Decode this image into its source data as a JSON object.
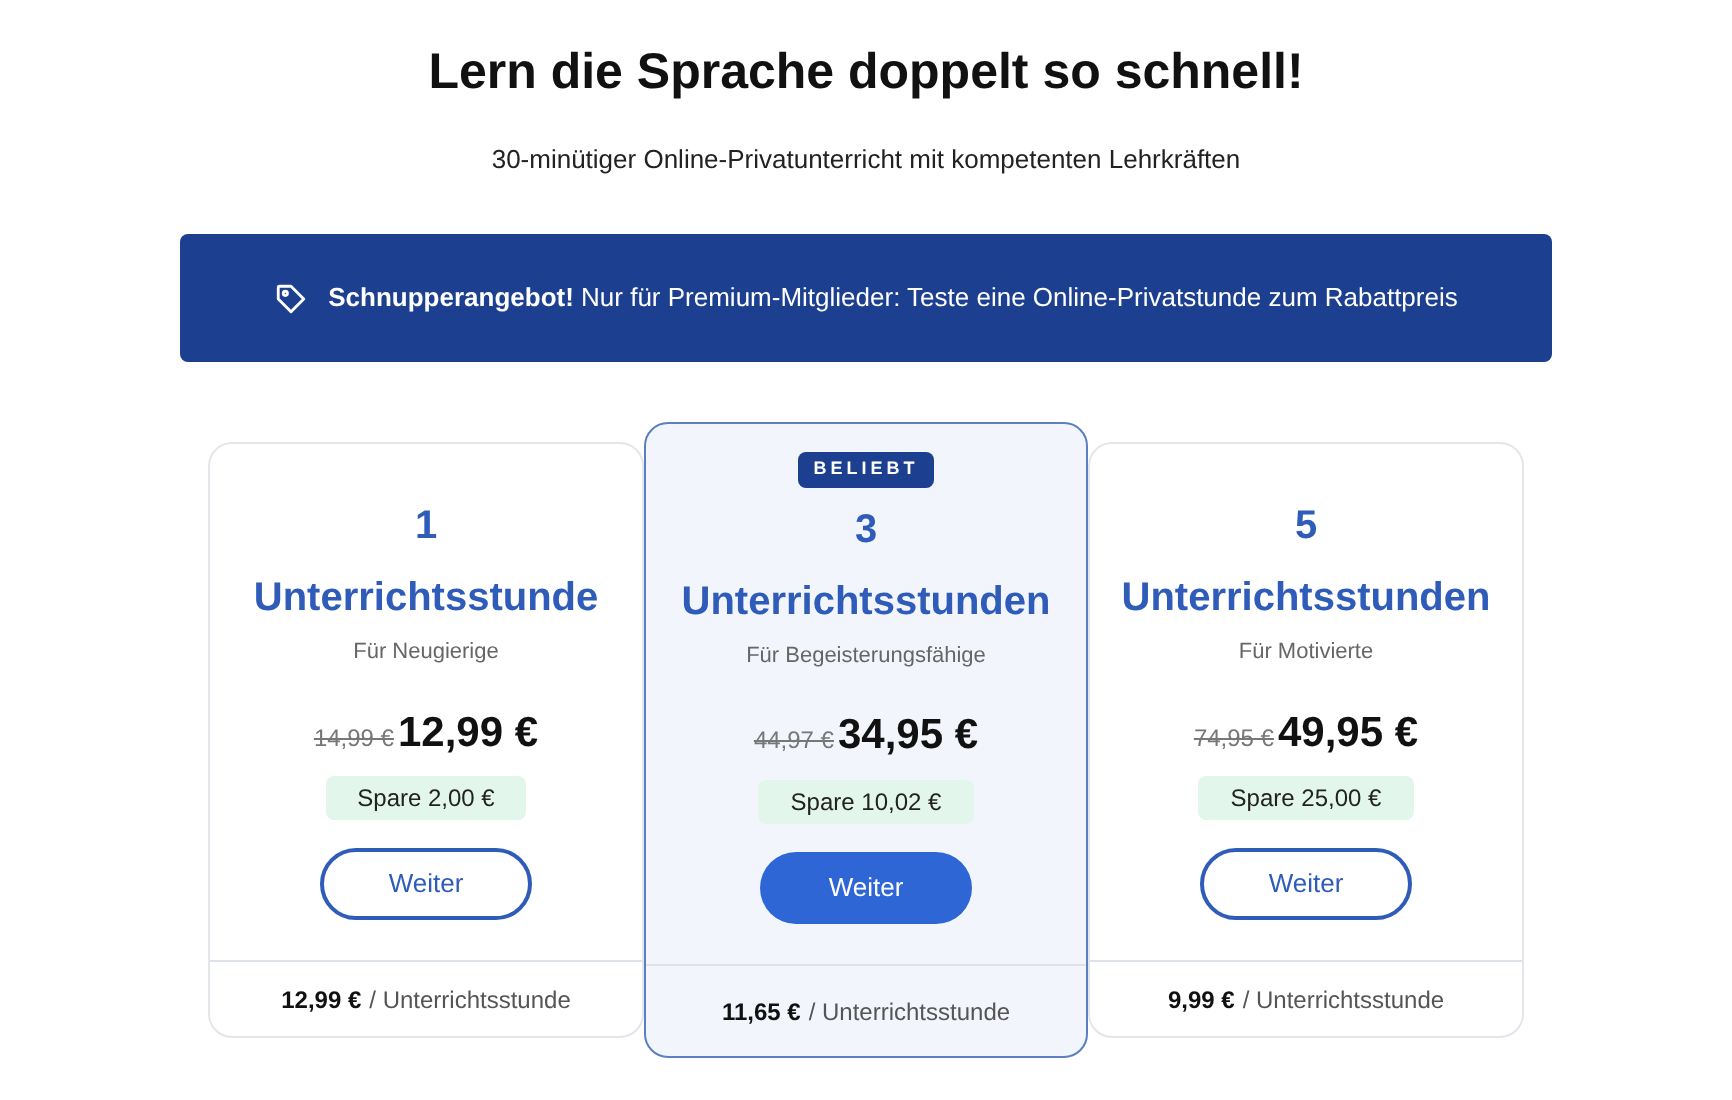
{
  "heading": "Lern die Sprache doppelt so schnell!",
  "subheading": "30-minütiger Online-Privatunterricht mit kompetenten Lehrkräften",
  "banner": {
    "text": "**Schnupperangebot!** Nur für Premium-Mitglieder: Teste eine Online-Privatstunde zum Rabattpreis"
  },
  "plans": [
    {
      "count": "1",
      "title": "Unterrichtsstunde",
      "subtitle": "Für Neugierige",
      "old_price": "14,99 €",
      "price": "12,99 €",
      "savings": "Spare 2,00 €",
      "button": "Weiter",
      "unit_price": "12,99 €",
      "unit_label": "/ Unterrichtsstunde",
      "selected": false
    },
    {
      "badge": "BELIEBT",
      "count": "3",
      "title": "Unterrichtsstunden",
      "subtitle": "Für Begeisterungsfähige",
      "old_price": "44,97 €",
      "price": "34,95 €",
      "savings": "Spare 10,02 €",
      "button": "Weiter",
      "unit_price": "11,65 €",
      "unit_label": "/ Unterrichtsstunde",
      "selected": true
    },
    {
      "count": "5",
      "title": "Unterrichtsstunden",
      "subtitle": "Für Motivierte",
      "old_price": "74,95 €",
      "price": "49,95 €",
      "savings": "Spare 25,00 €",
      "button": "Weiter",
      "unit_price": "9,99 €",
      "unit_label": "/ Unterrichtsstunde",
      "selected": false
    }
  ]
}
